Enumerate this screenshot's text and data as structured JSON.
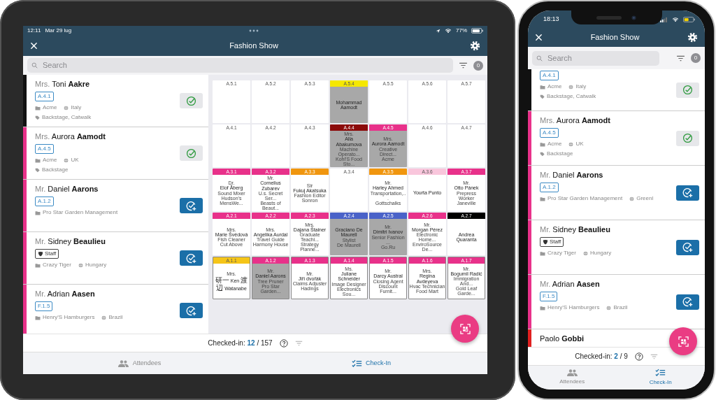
{
  "tablet": {
    "status_bar": {
      "time": "12:11",
      "date": "Mar 29 lug",
      "battery": "77%"
    },
    "title": "Fashion Show",
    "search": {
      "placeholder": "Search"
    },
    "filter_count": "0",
    "attendees": [
      {
        "title": "Mrs.",
        "first_name": "Toni",
        "last_name": "Aakre",
        "badge": {
          "kind": "seat",
          "label": "A.4.1"
        },
        "company": "Acme",
        "country": "Italy",
        "tags": "Backstage, Catwalk",
        "checked_in": true,
        "color": "#111111"
      },
      {
        "title": "Mrs.",
        "first_name": "Aurora",
        "last_name": "Aamodt",
        "badge": {
          "kind": "seat",
          "label": "A.4.5"
        },
        "company": "Acme",
        "country": "UK",
        "tags": "Backstage",
        "checked_in": true,
        "color": "#e8318a"
      },
      {
        "title": "Mr.",
        "first_name": "Daniel",
        "last_name": "Aarons",
        "badge": {
          "kind": "seat",
          "label": "A.1.2"
        },
        "company": "Pro Star Garden Management",
        "checked_in": false,
        "color": "#e8318a"
      },
      {
        "title": "Mr.",
        "first_name": "Sidney",
        "last_name": "Beaulieu",
        "badge": {
          "kind": "staff",
          "label": "Staff"
        },
        "company": "Crazy Tiger",
        "country": "Hungary",
        "checked_in": false,
        "color": "#e8318a"
      },
      {
        "title": "Mr.",
        "first_name": "Adrian",
        "last_name": "Aasen",
        "badge": {
          "kind": "seat",
          "label": "F.1.5"
        },
        "company": "Henry'S Hamburgers",
        "country": "Brazil",
        "checked_in": false,
        "color": "#e8318a"
      }
    ],
    "seat_rows": [
      {
        "outlined": false,
        "seats": [
          {
            "label": "A.5.1",
            "occupied": false
          },
          {
            "label": "A.5.2",
            "occupied": false
          },
          {
            "label": "A.5.3",
            "occupied": false
          },
          {
            "label": "A.5.4",
            "color": "#f5e800",
            "occupied": true,
            "name": "Mohammad Aamodt"
          },
          {
            "label": "A.5.5",
            "occupied": false
          },
          {
            "label": "A.5.6",
            "occupied": false
          },
          {
            "label": "A.5.7",
            "occupied": false
          }
        ]
      },
      {
        "outlined": false,
        "seats": [
          {
            "label": "A.4.1",
            "occupied": false
          },
          {
            "label": "A.4.2",
            "occupied": false
          },
          {
            "label": "A.4.3",
            "occupied": false
          },
          {
            "label": "A.4.4",
            "color": "#8b0a0a",
            "occupied": true,
            "title": "Mrs.",
            "name": "Alla Abakumova",
            "role": "Machine Operato...",
            "company": "Kohl'S Food Sto..."
          },
          {
            "label": "A.4.5",
            "color": "#e8318a",
            "occupied": true,
            "title": "Mrs.",
            "name": "Aurora Aamodt",
            "role": "Creative Direct...",
            "company": "Acme"
          },
          {
            "label": "A.4.6",
            "occupied": false
          },
          {
            "label": "A.4.7",
            "occupied": false
          }
        ]
      },
      {
        "outlined": false,
        "seats": [
          {
            "label": "A.3.1",
            "color": "#e8318a",
            "occupied": false,
            "title": "Dr.",
            "name": "Elof Åberg",
            "role": "Sound Mixer",
            "company": "Hudson's MensWe..."
          },
          {
            "label": "A.3.2",
            "color": "#e8318a",
            "occupied": false,
            "title": "Mr.",
            "name": "Cornelius Zubarev",
            "role": "U.s. Secret Ser...",
            "company": "Beasts of Beaut..."
          },
          {
            "label": "A.3.3",
            "color": "#f0960f",
            "occupied": false,
            "title": "Sir",
            "name": "Fukuj Akatsuka",
            "role": "Fashion Editor",
            "company": "Sonron"
          },
          {
            "label": "A.3.4",
            "occupied": false
          },
          {
            "label": "A.3.5",
            "color": "#f0960f",
            "occupied": false,
            "title": "Mr.",
            "name": "Harley Ahmed",
            "role": "Transportation,...",
            "company": "Gottschalks"
          },
          {
            "label": "A.3.6",
            "color": "#f9c6dc",
            "occupied": false,
            "name": "Yourta Punto"
          },
          {
            "label": "A.3.7",
            "color": "#e8318a",
            "occupied": false,
            "title": "Mr.",
            "name": "Otto Pánek",
            "role": "Prepress Worker",
            "company": "Janeville"
          }
        ]
      },
      {
        "outlined": false,
        "seats": [
          {
            "label": "A.2.1",
            "color": "#e8318a",
            "occupied": false,
            "title": "Mrs.",
            "name": "Marie Švédová",
            "role": "Fish Cleaner",
            "company": "Cut Above"
          },
          {
            "label": "A.2.2",
            "color": "#e8318a",
            "occupied": false,
            "title": "Mrs.",
            "name": "Angelika Aurdal",
            "role": "Travel Guide",
            "company": "Harmony House"
          },
          {
            "label": "A.2.3",
            "color": "#e8318a",
            "occupied": false,
            "title": "Mrs.",
            "name": "Dajana Štainer",
            "role": "Graduate Teachi...",
            "company": "Strategy Planne..."
          },
          {
            "label": "A.2.4",
            "color": "#4a62c8",
            "occupied": true,
            "name": "Graciano De Maurell",
            "role": "Stylist",
            "company": "De Maurell"
          },
          {
            "label": "A.2.5",
            "color": "#4a62c8",
            "occupied": true,
            "title": "Mr.",
            "name": "Dimitri Ivanov",
            "role": "Senior Fashion ...",
            "company": "Go.Ru"
          },
          {
            "label": "A.2.6",
            "color": "#e8318a",
            "occupied": false,
            "title": "Mr.",
            "name": "Morgan Pérez",
            "role": "Electronic Home...",
            "company": "EnviroSource De..."
          },
          {
            "label": "A.2.7",
            "color": "#000000",
            "occupied": false,
            "name": "Andrea Quaranta"
          }
        ]
      },
      {
        "outlined": true,
        "seats": [
          {
            "label": "A.1.1",
            "color": "#f5c518",
            "occupied": false,
            "title": "Mrs.",
            "name": "研一 Ken 渡辺 Watanabe"
          },
          {
            "label": "A.1.2",
            "color": "#e8318a",
            "occupied": true,
            "title": "Mr.",
            "name": "Daniel Aarons",
            "role": "Tree Pruner",
            "company": "Pro Star Garden..."
          },
          {
            "label": "A.1.3",
            "color": "#e8318a",
            "occupied": false,
            "title": "Mr.",
            "name": "Jiří dvořák",
            "role": "Claims Adjuster",
            "company": "Hadings"
          },
          {
            "label": "A.1.4",
            "color": "#e8318a",
            "occupied": false,
            "title": "Ms.",
            "name": "Juliane Schneider",
            "role": "Image Designer",
            "company": "Electronics Sou..."
          },
          {
            "label": "A.1.5",
            "color": "#e8318a",
            "occupied": false,
            "title": "Mr.",
            "name": "Darcy Austral",
            "role": "Closing Agent",
            "company": "Discount Furnit..."
          },
          {
            "label": "A.1.6",
            "color": "#e8318a",
            "occupied": false,
            "title": "Mrs.",
            "name": "Regina Avdeyeva",
            "role": "Hvac Technician",
            "company": "Food Mart"
          },
          {
            "label": "A.1.7",
            "color": "#e8318a",
            "occupied": false,
            "title": "Mr.",
            "name": "Bogumil Radić",
            "role": "Immigration And...",
            "company": "Gold Leaf Garde..."
          }
        ]
      }
    ],
    "footer": {
      "label": "Checked-in:",
      "count": "12",
      "total": "/ 157"
    },
    "tabs": [
      {
        "label": "Attendees",
        "selected": false
      },
      {
        "label": "Check-In",
        "selected": true
      }
    ]
  },
  "phone": {
    "status_bar": {
      "time": "18:13"
    },
    "title": "Fashion Show",
    "search": {
      "placeholder": "Search"
    },
    "filter_count": "0",
    "attendees": [
      {
        "badge": {
          "kind": "seat",
          "label": "A.4.1"
        },
        "company": "Acme",
        "country": "Italy",
        "tags": "Backstage, Catwalk",
        "checked_in": true,
        "color": "#111111"
      },
      {
        "title": "Mrs.",
        "first_name": "Aurora",
        "last_name": "Aamodt",
        "badge": {
          "kind": "seat",
          "label": "A.4.5"
        },
        "company": "Acme",
        "country": "UK",
        "tags": "Backstage",
        "checked_in": true,
        "color": "#e8318a"
      },
      {
        "title": "Mr.",
        "first_name": "Daniel",
        "last_name": "Aarons",
        "badge": {
          "kind": "seat",
          "label": "A.1.2"
        },
        "company": "Pro Star Garden Management",
        "country": "Greenl",
        "checked_in": false,
        "color": "#e8318a"
      },
      {
        "title": "Mr.",
        "first_name": "Sidney",
        "last_name": "Beaulieu",
        "badge": {
          "kind": "staff",
          "label": "Staff"
        },
        "company": "Crazy Tiger",
        "country": "Hungary",
        "checked_in": false,
        "color": "#e8318a"
      },
      {
        "title": "Mr.",
        "first_name": "Adrian",
        "last_name": "Aasen",
        "badge": {
          "kind": "seat",
          "label": "F.1.5"
        },
        "company": "Henry'S Hamburgers",
        "country": "Brazil",
        "checked_in": false,
        "color": "#e8318a"
      },
      {
        "first_name": "Paolo",
        "last_name": "Gobbi",
        "color": "#e02020"
      }
    ],
    "footer": {
      "label": "Checked-in:",
      "count": "2",
      "total": "/ 9"
    },
    "tabs": [
      {
        "label": "Attendees",
        "selected": false
      },
      {
        "label": "Check-In",
        "selected": true
      }
    ]
  }
}
